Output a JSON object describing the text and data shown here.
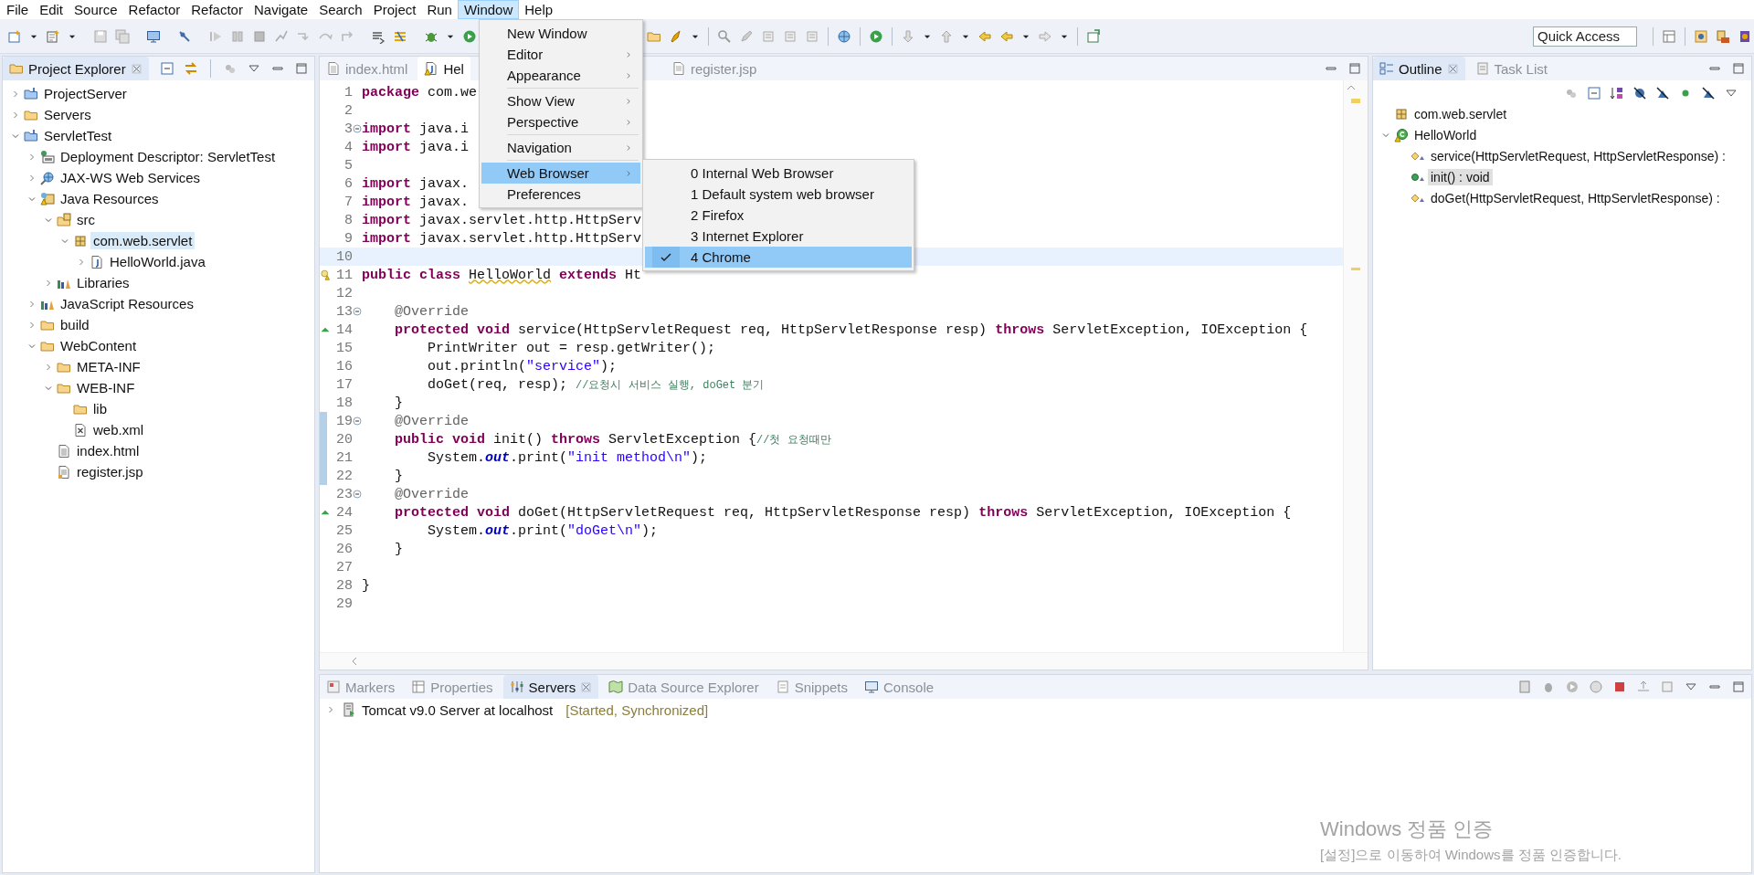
{
  "menubar": [
    {
      "label": "File",
      "selected": false
    },
    {
      "label": "Edit",
      "selected": false
    },
    {
      "label": "Source",
      "selected": false
    },
    {
      "label": "Refactor",
      "selected": false
    },
    {
      "label": "Refactor",
      "selected": false
    },
    {
      "label": "Navigate",
      "selected": false
    },
    {
      "label": "Search",
      "selected": false
    },
    {
      "label": "Project",
      "selected": false
    },
    {
      "label": "Run",
      "selected": false
    },
    {
      "label": "Window",
      "selected": true
    },
    {
      "label": "Help",
      "selected": false
    }
  ],
  "toolbar": {
    "quick_access": {
      "placeholder": "Quick Access"
    }
  },
  "window_menu": {
    "items": [
      {
        "kind": "item",
        "label": "New Window",
        "submenu": false,
        "selected": false
      },
      {
        "kind": "item",
        "label": "Editor",
        "submenu": true,
        "selected": false
      },
      {
        "kind": "item",
        "label": "Appearance",
        "submenu": true,
        "selected": false
      },
      {
        "kind": "separator"
      },
      {
        "kind": "item",
        "label": "Show View",
        "submenu": true,
        "selected": false
      },
      {
        "kind": "item",
        "label": "Perspective",
        "submenu": true,
        "selected": false
      },
      {
        "kind": "separator"
      },
      {
        "kind": "item",
        "label": "Navigation",
        "submenu": true,
        "selected": false
      },
      {
        "kind": "separator"
      },
      {
        "kind": "item",
        "label": "Web Browser",
        "submenu": true,
        "selected": true
      },
      {
        "kind": "item",
        "label": "Preferences",
        "submenu": false,
        "selected": false
      }
    ],
    "web_browser_submenu": [
      {
        "label": "0 Internal Web Browser",
        "checked": false
      },
      {
        "label": "1 Default system web browser",
        "checked": false
      },
      {
        "label": "2 Firefox",
        "checked": false
      },
      {
        "label": "3 Internet Explorer",
        "checked": false
      },
      {
        "label": "4 Chrome",
        "checked": true
      }
    ]
  },
  "project_explorer": {
    "title": "Project Explorer",
    "items": [
      {
        "kind": "project",
        "label": "ProjectServer",
        "expanded": false,
        "selected": false
      },
      {
        "kind": "folder",
        "label": "Servers",
        "expanded": false,
        "selected": false
      },
      {
        "kind": "project",
        "label": "ServletTest",
        "expanded": true,
        "selected": false,
        "children": [
          {
            "kind": "descriptor",
            "label": "Deployment Descriptor: ServletTest",
            "expanded": false,
            "selected": false
          },
          {
            "kind": "webservices",
            "label": "JAX-WS Web Services",
            "expanded": false,
            "selected": false
          },
          {
            "kind": "java-resources",
            "label": "Java Resources",
            "expanded": true,
            "selected": false,
            "children": [
              {
                "kind": "source-folder",
                "label": "src",
                "expanded": true,
                "selected": false,
                "children": [
                  {
                    "kind": "package",
                    "label": "com.web.servlet",
                    "expanded": true,
                    "selected": true,
                    "children": [
                      {
                        "kind": "java-file",
                        "label": "HelloWorld.java",
                        "expanded": false,
                        "selected": false
                      }
                    ]
                  }
                ]
              },
              {
                "kind": "library",
                "label": "Libraries",
                "expanded": false,
                "selected": false
              }
            ]
          },
          {
            "kind": "library",
            "label": "JavaScript Resources",
            "expanded": false,
            "selected": false
          },
          {
            "kind": "folder",
            "label": "build",
            "expanded": false,
            "selected": false
          },
          {
            "kind": "folder",
            "label": "WebContent",
            "expanded": true,
            "selected": false,
            "children": [
              {
                "kind": "folder",
                "label": "META-INF",
                "expanded": false,
                "selected": false
              },
              {
                "kind": "folder",
                "label": "WEB-INF",
                "expanded": true,
                "selected": false,
                "children": [
                  {
                    "kind": "folder",
                    "label": "lib",
                    "selected": false
                  },
                  {
                    "kind": "xml-file",
                    "label": "web.xml",
                    "selected": false
                  }
                ]
              },
              {
                "kind": "file",
                "label": "index.html",
                "selected": false
              },
              {
                "kind": "jsp-file",
                "label": "register.jsp",
                "selected": false
              }
            ]
          }
        ]
      }
    ]
  },
  "editor": {
    "tabs": [
      {
        "label": "index.html",
        "kind": "html",
        "selected": false
      },
      {
        "label": "Hel",
        "kind": "java",
        "selected": true
      },
      {
        "label": "register.jsp",
        "kind": "jsp",
        "selected": false
      }
    ],
    "lines": [
      {
        "number": "1",
        "kind": "plain",
        "current": false,
        "fold": false,
        "changed": false,
        "segments": [
          {
            "kind": "keyword",
            "text": "package"
          },
          {
            "kind": "plain",
            "text": " com.we"
          }
        ]
      },
      {
        "number": "2",
        "kind": "plain",
        "current": false,
        "fold": false,
        "changed": false
      },
      {
        "number": "3",
        "kind": "plain",
        "current": false,
        "fold": true,
        "changed": false,
        "segments": [
          {
            "kind": "keyword",
            "text": "import"
          },
          {
            "kind": "plain",
            "text": " java.i"
          }
        ]
      },
      {
        "number": "4",
        "kind": "plain",
        "current": false,
        "fold": false,
        "changed": false,
        "segments": [
          {
            "kind": "keyword",
            "text": "import"
          },
          {
            "kind": "plain",
            "text": " java.i"
          }
        ]
      },
      {
        "number": "5",
        "kind": "plain",
        "current": false,
        "fold": false,
        "changed": false
      },
      {
        "number": "6",
        "kind": "plain",
        "current": false,
        "fold": false,
        "changed": false,
        "segments": [
          {
            "kind": "keyword",
            "text": "import"
          },
          {
            "kind": "plain",
            "text": " javax."
          }
        ]
      },
      {
        "number": "7",
        "kind": "plain",
        "current": false,
        "fold": false,
        "changed": false,
        "segments": [
          {
            "kind": "keyword",
            "text": "import"
          },
          {
            "kind": "plain",
            "text": " javax."
          }
        ]
      },
      {
        "number": "8",
        "kind": "plain",
        "current": false,
        "fold": false,
        "changed": false,
        "segments": [
          {
            "kind": "keyword",
            "text": "import"
          },
          {
            "kind": "plain",
            "text": " javax.servlet.http.HttpServ"
          }
        ]
      },
      {
        "number": "9",
        "kind": "plain",
        "current": false,
        "fold": false,
        "changed": false,
        "segments": [
          {
            "kind": "keyword",
            "text": "import"
          },
          {
            "kind": "plain",
            "text": " javax.servlet.http.HttpServ"
          }
        ]
      },
      {
        "number": "10",
        "kind": "plain",
        "current": true,
        "fold": false,
        "changed": false
      },
      {
        "number": "11",
        "kind": "warning",
        "current": false,
        "fold": false,
        "changed": false,
        "segments": [
          {
            "kind": "keyword",
            "text": "public class "
          },
          {
            "kind": "warning",
            "text": "HelloWorld"
          },
          {
            "kind": "keyword",
            "text": " extends"
          },
          {
            "kind": "plain",
            "text": " Ht"
          }
        ]
      },
      {
        "number": "12",
        "kind": "plain",
        "current": false,
        "fold": false,
        "changed": false
      },
      {
        "number": "13",
        "kind": "plain",
        "current": false,
        "fold": true,
        "changed": false,
        "segments": [
          {
            "kind": "annotation",
            "text": "    @Override"
          }
        ]
      },
      {
        "number": "14",
        "kind": "override",
        "current": false,
        "fold": false,
        "changed": false,
        "segments": [
          {
            "kind": "keyword",
            "text": "    protected void"
          },
          {
            "kind": "plain",
            "text": " service(HttpServletRequest req, HttpServletResponse resp) "
          },
          {
            "kind": "keyword",
            "text": "throws"
          },
          {
            "kind": "plain",
            "text": " ServletException, IOException {"
          }
        ]
      },
      {
        "number": "15",
        "kind": "plain",
        "current": false,
        "fold": false,
        "changed": false,
        "segments": [
          {
            "kind": "plain",
            "text": "        PrintWriter out = resp.getWriter();"
          }
        ]
      },
      {
        "number": "16",
        "kind": "plain",
        "current": false,
        "fold": false,
        "changed": false,
        "segments": [
          {
            "kind": "plain",
            "text": "        out.println("
          },
          {
            "kind": "string",
            "text": "\"service\""
          },
          {
            "kind": "plain",
            "text": ");"
          }
        ]
      },
      {
        "number": "17",
        "kind": "plain",
        "current": false,
        "fold": false,
        "changed": false,
        "segments": [
          {
            "kind": "plain",
            "text": "        doGet(req, resp); "
          },
          {
            "kind": "comment",
            "text": "//요청시 서비스 실행, doGet 분기"
          }
        ]
      },
      {
        "number": "18",
        "kind": "plain",
        "current": false,
        "fold": false,
        "changed": false,
        "segments": [
          {
            "kind": "plain",
            "text": "    }"
          }
        ]
      },
      {
        "number": "19",
        "kind": "plain",
        "current": false,
        "fold": true,
        "changed": true,
        "segments": [
          {
            "kind": "annotation",
            "text": "    @Override"
          }
        ]
      },
      {
        "number": "20",
        "kind": "plain",
        "current": false,
        "fold": false,
        "changed": true,
        "segments": [
          {
            "kind": "keyword",
            "text": "    public void"
          },
          {
            "kind": "plain",
            "text": " init() "
          },
          {
            "kind": "keyword",
            "text": "throws"
          },
          {
            "kind": "plain",
            "text": " ServletException {"
          },
          {
            "kind": "comment",
            "text": "//첫 요청때만"
          }
        ]
      },
      {
        "number": "21",
        "kind": "plain",
        "current": false,
        "fold": false,
        "changed": true,
        "segments": [
          {
            "kind": "plain",
            "text": "        System."
          },
          {
            "kind": "field",
            "text": "out"
          },
          {
            "kind": "plain",
            "text": ".print("
          },
          {
            "kind": "string",
            "text": "\"init method\\n\""
          },
          {
            "kind": "plain",
            "text": ");"
          }
        ]
      },
      {
        "number": "22",
        "kind": "plain",
        "current": false,
        "fold": false,
        "changed": true,
        "segments": [
          {
            "kind": "plain",
            "text": "    }"
          }
        ]
      },
      {
        "number": "23",
        "kind": "plain",
        "current": false,
        "fold": true,
        "changed": false,
        "segments": [
          {
            "kind": "annotation",
            "text": "    @Override"
          }
        ]
      },
      {
        "number": "24",
        "kind": "override",
        "current": false,
        "fold": false,
        "changed": false,
        "segments": [
          {
            "kind": "keyword",
            "text": "    protected void"
          },
          {
            "kind": "plain",
            "text": " doGet(HttpServletRequest req, HttpServletResponse resp) "
          },
          {
            "kind": "keyword",
            "text": "throws"
          },
          {
            "kind": "plain",
            "text": " ServletException, IOException {"
          }
        ]
      },
      {
        "number": "25",
        "kind": "plain",
        "current": false,
        "fold": false,
        "changed": false,
        "segments": [
          {
            "kind": "plain",
            "text": "        System."
          },
          {
            "kind": "field",
            "text": "out"
          },
          {
            "kind": "plain",
            "text": ".print("
          },
          {
            "kind": "string",
            "text": "\"doGet\\n\""
          },
          {
            "kind": "plain",
            "text": ");"
          }
        ]
      },
      {
        "number": "26",
        "kind": "plain",
        "current": false,
        "fold": false,
        "changed": false,
        "segments": [
          {
            "kind": "plain",
            "text": "    }"
          }
        ]
      },
      {
        "number": "27",
        "kind": "plain",
        "current": false,
        "fold": false,
        "changed": false
      },
      {
        "number": "28",
        "kind": "plain",
        "current": false,
        "fold": false,
        "changed": false,
        "segments": [
          {
            "kind": "plain",
            "text": "}"
          }
        ]
      },
      {
        "number": "29",
        "kind": "plain",
        "current": false,
        "fold": false,
        "changed": false
      }
    ]
  },
  "outline": {
    "tabs": [
      {
        "label": "Outline",
        "selected": true
      },
      {
        "label": "Task List",
        "selected": false
      }
    ],
    "items": [
      {
        "kind": "package",
        "label": "com.web.servlet",
        "selected": false
      },
      {
        "kind": "class",
        "label": "HelloWorld",
        "expanded": true,
        "selected": false,
        "children": [
          {
            "kind": "protected-method",
            "label": "service(HttpServletRequest, HttpServletResponse) :",
            "selected": false
          },
          {
            "kind": "public-method",
            "label": "init() : void",
            "selected": true
          },
          {
            "kind": "protected-method",
            "label": "doGet(HttpServletRequest, HttpServletResponse) :",
            "selected": false
          }
        ]
      }
    ]
  },
  "bottom_panel": {
    "tabs": [
      {
        "label": "Markers",
        "kind": "markers",
        "selected": false
      },
      {
        "label": "Properties",
        "kind": "properties",
        "selected": false
      },
      {
        "label": "Servers",
        "kind": "servers",
        "selected": true
      },
      {
        "label": "Data Source Explorer",
        "kind": "datasource",
        "selected": false
      },
      {
        "label": "Snippets",
        "kind": "snippets",
        "selected": false
      },
      {
        "label": "Console",
        "kind": "console",
        "selected": false
      }
    ],
    "servers": [
      {
        "name": "Tomcat v9.0 Server at localhost",
        "status": "[Started, Synchronized]",
        "expanded": false
      }
    ]
  },
  "activation_notice": {
    "title": "Windows 정품 인증",
    "message": "[설정]으로 이동하여 Windows를 정품 인증합니다."
  }
}
